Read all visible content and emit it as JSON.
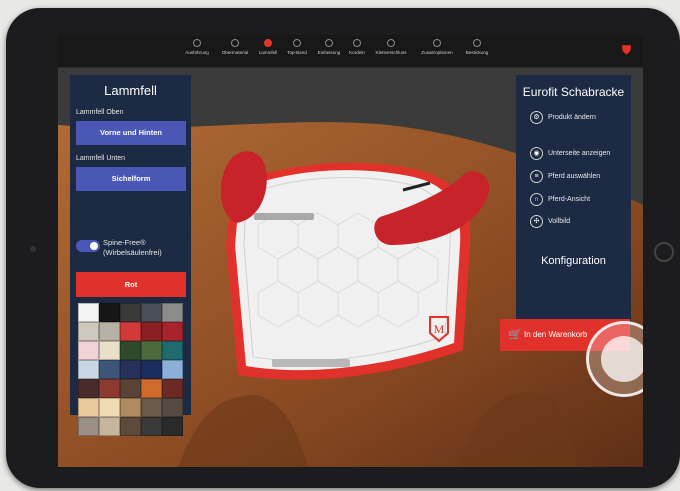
{
  "nav": {
    "items": [
      {
        "label": "Ausführung"
      },
      {
        "label": "Obermaterial"
      },
      {
        "label": "Lammfell"
      },
      {
        "label": "Top-Band"
      },
      {
        "label": "Einfassung"
      },
      {
        "label": "Kordeln"
      },
      {
        "label": "Klettverschluss"
      },
      {
        "label": "Zusatzoptionen"
      },
      {
        "label": "Bestickung"
      }
    ],
    "active_index": 2
  },
  "left_panel": {
    "title": "Lammfell",
    "top_label": "Lammfell Oben",
    "top_value": "Vorne und Hinten",
    "bottom_label": "Lammfell Unten",
    "bottom_value": "Sichelform",
    "spine_line1": "Spine-Free®",
    "spine_line2": "(Wirbelsäulenfrei)",
    "spine_enabled": true,
    "color_value": "Rot",
    "swatches": [
      "#f4f4f4",
      "#161616",
      "#3a3a3a",
      "#4a4f57",
      "#8c8c8c",
      "#cfc8bd",
      "#b7b0a5",
      "#d23a3a",
      "#8a1f24",
      "#a8232b",
      "#f0d2d6",
      "#e8e0c8",
      "#2e4a2b",
      "#4c6b3c",
      "#1e6a6e",
      "#c9d6e4",
      "#3c5578",
      "#26305a",
      "#1a2d5c",
      "#8ab0d8",
      "#4a2b2b",
      "#8c3a30",
      "#5a4336",
      "#d06a2b",
      "#6b2b24",
      "#e8c89a",
      "#f0dcb4",
      "#b08a60",
      "#6a5a4a",
      "#574a40",
      "#9a8f84",
      "#c7b49c",
      "#5c4a3a",
      "#3a3a3a",
      "#2a2a2a"
    ]
  },
  "right_panel": {
    "title": "Eurofit Schabracke",
    "product_change": "Produkt ändern",
    "show_underside": "Unterseite anzeigen",
    "select_horse": "Pferd auswählen",
    "horse_view": "Pferd-Ansicht",
    "fullscreen": "Vollbild",
    "config_title": "Konfiguration",
    "cart_label": "In den Warenkorb"
  },
  "colors": {
    "accent_red": "#e0322b",
    "panel_navy": "#1d2a44",
    "button_blue": "#4a57b5"
  }
}
